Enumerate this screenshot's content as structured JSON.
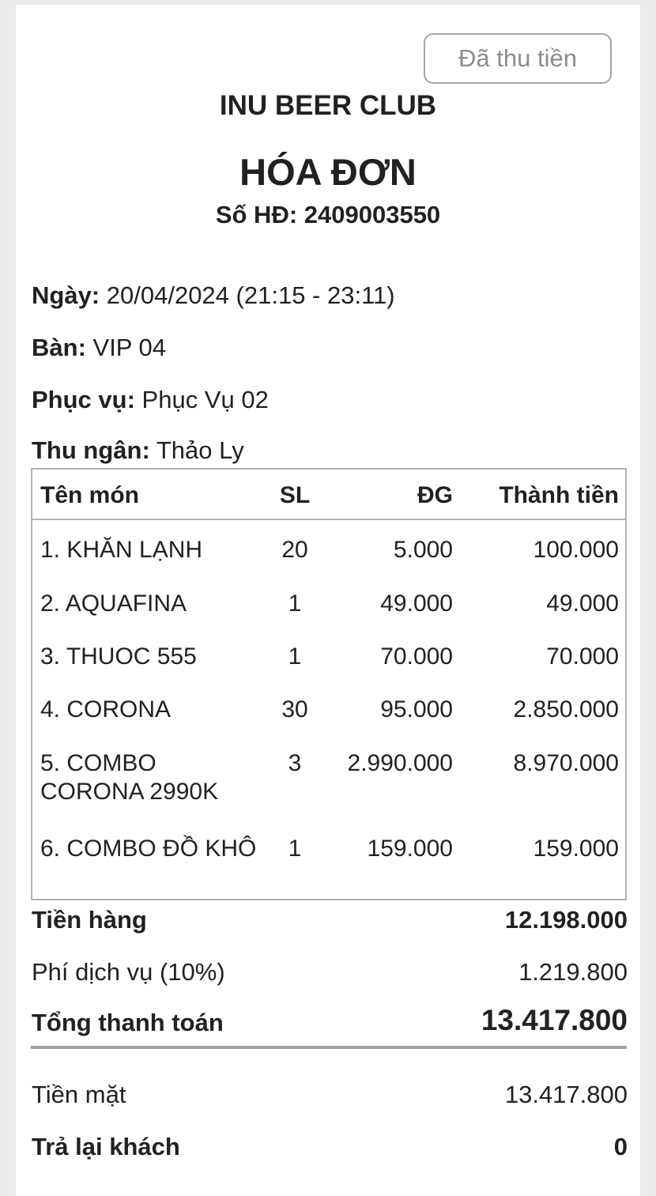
{
  "badge": "Đã thu tiền",
  "store_name": "INU BEER CLUB",
  "doc_title": "HÓA ĐƠN",
  "invoice_no": "Số HĐ: 2409003550",
  "info": {
    "date_label": "Ngày:",
    "date_value": "20/04/2024 (21:15 - 23:11)",
    "table_label": "Bàn:",
    "table_value": "VIP 04",
    "server_label": "Phục vụ:",
    "server_value": "Phục Vụ 02",
    "cashier_label": "Thu ngân:",
    "cashier_value": "Thảo Ly"
  },
  "table": {
    "headers": [
      "Tên món",
      "SL",
      "ĐG",
      "Thành tiền"
    ],
    "rows": [
      {
        "name": "1. KHĂN LẠNH",
        "qty": "20",
        "price": "5.000",
        "total": "100.000"
      },
      {
        "name": "2. AQUAFINA",
        "qty": "1",
        "price": "49.000",
        "total": "49.000"
      },
      {
        "name": "3. THUOC 555",
        "qty": "1",
        "price": "70.000",
        "total": "70.000"
      },
      {
        "name": "4. CORONA",
        "qty": "30",
        "price": "95.000",
        "total": "2.850.000"
      },
      {
        "name": "5. COMBO CORONA 2990K",
        "qty": "3",
        "price": "2.990.000",
        "total": "8.970.000"
      },
      {
        "name": "6. COMBO ĐỒ KHÔ",
        "qty": "1",
        "price": "159.000",
        "total": "159.000"
      }
    ]
  },
  "summary": {
    "subtotal_label": "Tiền hàng",
    "subtotal_value": "12.198.000",
    "fee_label": "Phí dịch vụ (10%)",
    "fee_value": "1.219.800",
    "total_label": "Tổng thanh toán",
    "total_value": "13.417.800",
    "cash_label": "Tiền mặt",
    "cash_value": "13.417.800",
    "change_label": "Trả lại khách",
    "change_value": "0"
  }
}
